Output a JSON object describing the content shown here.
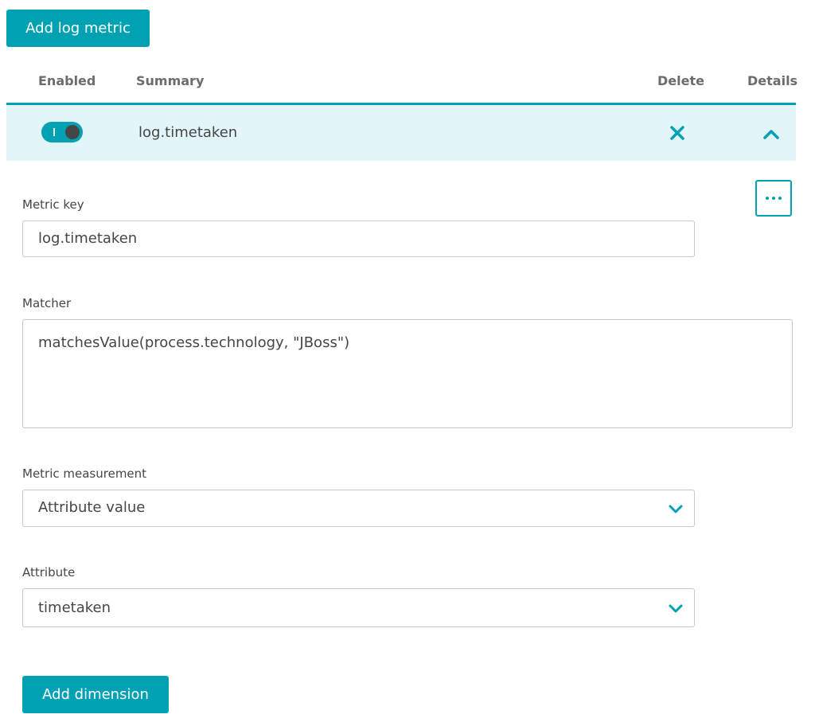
{
  "toolbar": {
    "add_log_metric_label": "Add log metric"
  },
  "table": {
    "headers": {
      "enabled": "Enabled",
      "summary": "Summary",
      "delete": "Delete",
      "details": "Details"
    },
    "row": {
      "enabled": true,
      "summary": "log.timetaken"
    }
  },
  "form": {
    "metric_key": {
      "label": "Metric key",
      "value": "log.timetaken"
    },
    "matcher": {
      "label": "Matcher",
      "value": "matchesValue(process.technology, \"JBoss\")"
    },
    "metric_measurement": {
      "label": "Metric measurement",
      "value": "Attribute value"
    },
    "attribute": {
      "label": "Attribute",
      "value": "timetaken"
    },
    "add_dimension_label": "Add dimension"
  },
  "icons": {
    "delete": "close-icon",
    "details": "chevron-up-icon",
    "more": "more-horizontal-icon",
    "dropdown": "chevron-down-icon"
  },
  "colors": {
    "accent": "#00a1b2",
    "row_highlight": "#e2f6f9",
    "text": "#454646"
  }
}
